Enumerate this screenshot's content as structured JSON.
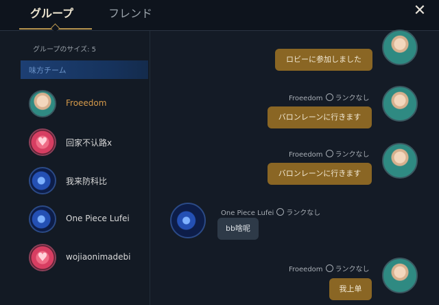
{
  "tabs": {
    "group": "グループ",
    "friends": "フレンド"
  },
  "close_label": "✕",
  "sidebar": {
    "group_size": "グループのサイズ: 5",
    "team_label": "味方チーム",
    "members": [
      {
        "name": "Froeedom",
        "avatar": "poro"
      },
      {
        "name": "回家不认路x",
        "avatar": "heart"
      },
      {
        "name": "我来防科比",
        "avatar": "blue"
      },
      {
        "name": "One Piece Lufei",
        "avatar": "blue"
      },
      {
        "name": "wojiaonimadebi",
        "avatar": "heart"
      }
    ]
  },
  "chat": {
    "messages": [
      {
        "sender": "",
        "rank": "",
        "text": "ロビーに参加しました"
      },
      {
        "sender": "Froeedom",
        "rank": "ランクなし",
        "text": "バロンレーンに行きます"
      },
      {
        "sender": "Froeedom",
        "rank": "ランクなし",
        "text": "バロンレーンに行きます"
      },
      {
        "sender": "One Piece Lufei",
        "rank": "ランクなし",
        "text": "bb啥呢"
      },
      {
        "sender": "Froeedom",
        "rank": "ランクなし",
        "text": "我上单"
      }
    ]
  }
}
